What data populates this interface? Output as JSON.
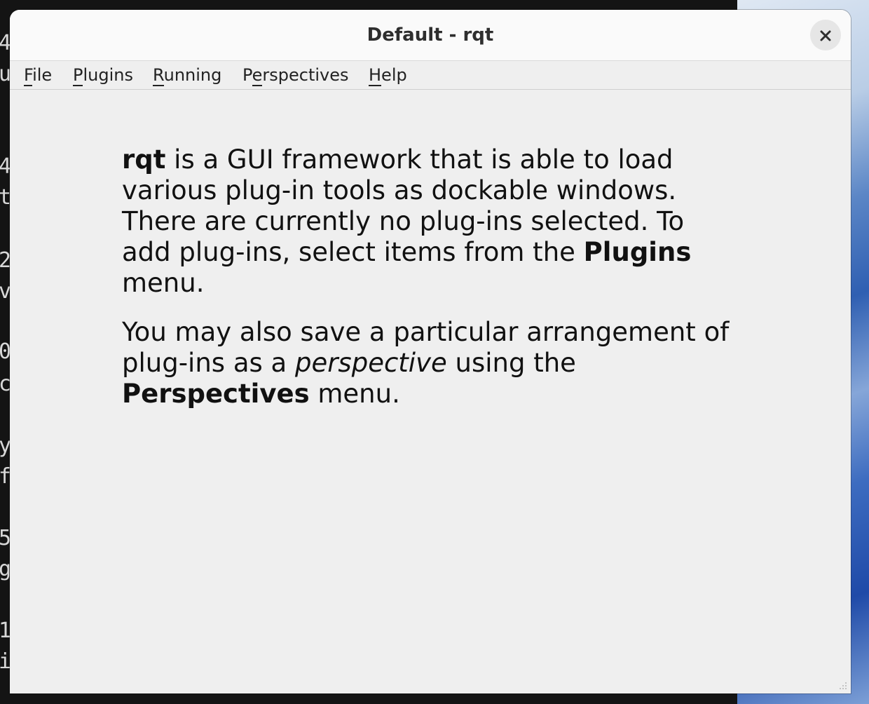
{
  "window": {
    "title": "Default - rqt"
  },
  "menubar": {
    "items": [
      {
        "label": "File",
        "mnemonic": "F",
        "rest": "ile"
      },
      {
        "label": "Plugins",
        "mnemonic": "P",
        "rest": "lugins"
      },
      {
        "label": "Running",
        "mnemonic": "R",
        "rest": "unning"
      },
      {
        "label": "Perspectives",
        "pre": "P",
        "mnemonic": "e",
        "rest": "rspectives"
      },
      {
        "label": "Help",
        "mnemonic": "H",
        "rest": "elp"
      }
    ]
  },
  "intro": {
    "p1_bold_start": "rqt",
    "p1_text": " is a GUI framework that is able to load various plug-in tools as dockable windows. There are currently no plug-ins selected. To add plug-ins, select items from the ",
    "p1_bold_menu": "Plugins",
    "p1_end": " menu.",
    "p2_text": "You may also save a particular arrangement of plug-ins as a ",
    "p2_italic": "perspective",
    "p2_mid": " using the ",
    "p2_bold_menu": "Perspectives",
    "p2_end": " menu."
  },
  "background_terminal": {
    "chars": [
      "4",
      "u",
      "4",
      "t",
      "2",
      "v",
      "0",
      "c",
      "y",
      "f",
      "5",
      "g",
      "1",
      "i"
    ]
  },
  "colors": {
    "window_bg": "#efefef",
    "titlebar_bg": "#fafafa",
    "text": "#111111"
  },
  "icons": {
    "close": "close-icon",
    "resize": "resize-grip-icon"
  }
}
